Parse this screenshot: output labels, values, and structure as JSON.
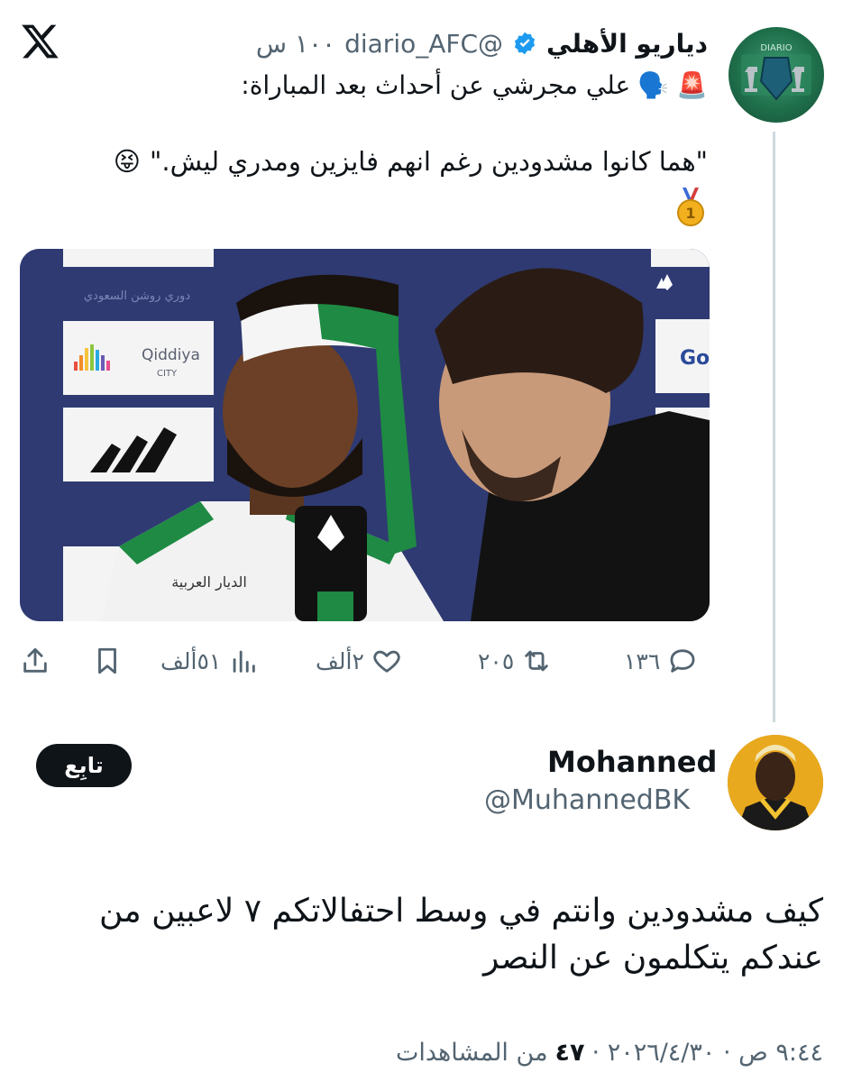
{
  "app": {
    "logo_icon": "x-logo-icon"
  },
  "tweet": {
    "author_name": "دياريو الأهلي",
    "author_handle": "@diario_AFC",
    "time": "١٠٠ س",
    "line1": "علي مجرشي عن أحداث بعد المباراة:",
    "line1_emojis": [
      "🚨",
      "🗣️"
    ],
    "quote": "\"هما كانوا مشدودين رغم انهم فايزين ومدري ليش.\"",
    "quote_emoji": "😝",
    "medal_emoji": "🥇",
    "media": {
      "sponsor1": "Qiddiya",
      "sponsor1_sub": "CITY",
      "badge_text": "الديار العربية",
      "league_text": "دوري روشن السعودي",
      "partial_sponsor": "Go"
    },
    "actions": {
      "replies": "١٣٦",
      "retweets": "٢٠٥",
      "likes": "٢ألف",
      "views": "٥١ألف"
    }
  },
  "reply": {
    "author_name": "Mohanned",
    "author_handle": "@MuhannedBK",
    "follow_label": "تابِع",
    "text": "كيف مشدودين وانتم في وسط احتفالاتكم ٧ لاعبين من عندكم يتكلمون عن النصر",
    "timestamp": "٩:٤٤ ص · ٢٠٢٦/٤/٣٠ ·",
    "views_count": "٤٧",
    "views_label": "من المشاهدات"
  },
  "colors": {
    "text": "#0f1419",
    "muted": "#536471",
    "verified": "#1d9bf0",
    "ahli_green": "#1a7f3c"
  }
}
